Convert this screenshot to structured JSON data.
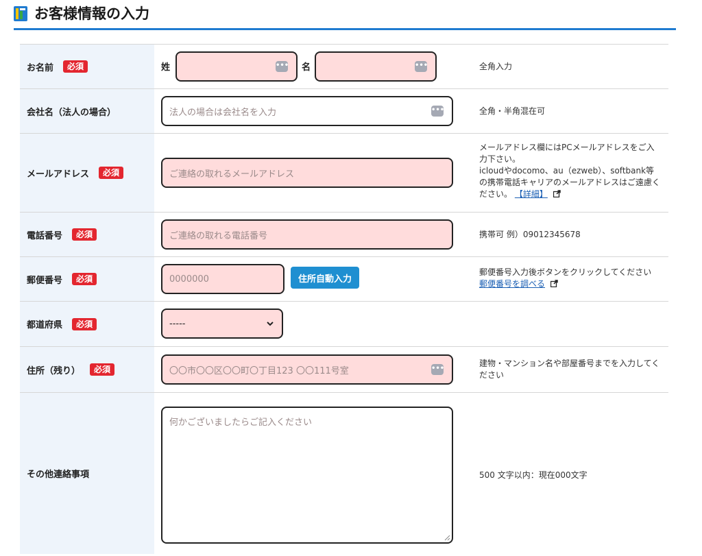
{
  "header": {
    "title": "お客様情報の入力"
  },
  "required_label": "必須",
  "name": {
    "label": "お名前",
    "sei_label": "姓",
    "mei_label": "名",
    "note": "全角入力"
  },
  "company": {
    "label": "会社名（法人の場合）",
    "placeholder": "法人の場合は会社名を入力",
    "note": "全角・半角混在可"
  },
  "email": {
    "label": "メールアドレス",
    "placeholder": "ご連絡の取れるメールアドレス",
    "note_lines": [
      "メールアドレス欄にはPCメールアドレスをご入",
      "力下さい。",
      "icloudやdocomo、au（ezweb）、softbank等",
      "の携帯電話キャリアのメールアドレスはご遠慮く"
    ],
    "note_last": "ださい。",
    "detail_link": "【詳細】"
  },
  "phone": {
    "label": "電話番号",
    "placeholder": "ご連絡の取れる電話番号",
    "note": "携帯可 例）09012345678"
  },
  "zip": {
    "label": "郵便番号",
    "placeholder": "0000000",
    "button": "住所自動入力",
    "note": "郵便番号入力後ボタンをクリックしてください",
    "lookup_link": "郵便番号を調べる"
  },
  "prefecture": {
    "label": "都道府県",
    "selected": "-----"
  },
  "address": {
    "label": "住所（残り）",
    "placeholder": "〇〇市〇〇区〇〇町〇丁目123 〇〇111号室",
    "note_lines": [
      "建物・マンション名や部屋番号までを入力してく",
      "ださい"
    ]
  },
  "other": {
    "label": "その他連絡事項",
    "placeholder": "何かございましたらご記入ください",
    "note": "500 文字以内：現在000文字"
  },
  "colors": {
    "accent": "#1f7bd0",
    "required": "#e3262f",
    "field_bg": "#ffdcdc",
    "label_bg": "#eef4fb",
    "button": "#1f8fd1"
  }
}
